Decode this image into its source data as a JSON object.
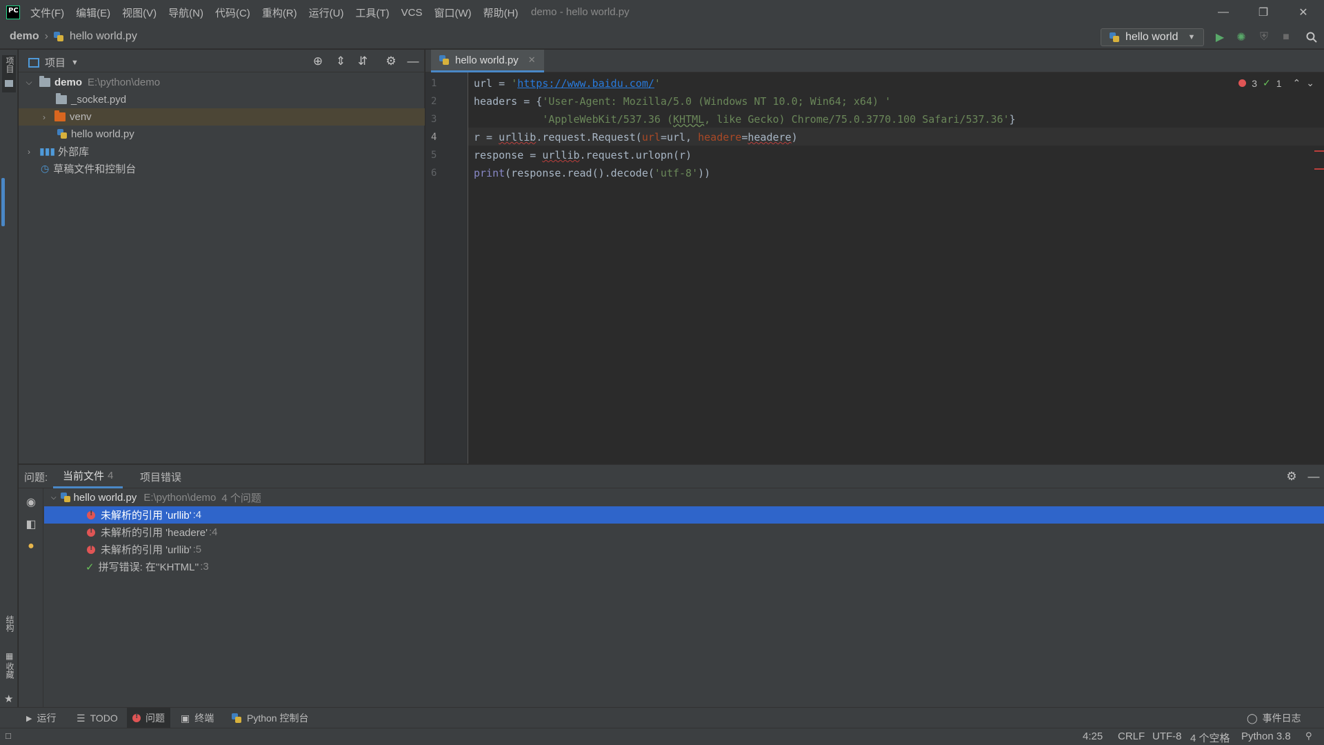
{
  "window": {
    "title": "demo - hello world.py",
    "menu": [
      "文件(F)",
      "编辑(E)",
      "视图(V)",
      "导航(N)",
      "代码(C)",
      "重构(R)",
      "运行(U)",
      "工具(T)",
      "VCS",
      "窗口(W)",
      "帮助(H)"
    ]
  },
  "breadcrumb": {
    "project": "demo",
    "file": "hello world.py"
  },
  "run_config": {
    "label": "hello world"
  },
  "left_strip": {
    "project_label": "项目",
    "structure_label": "结构",
    "favorites_label": "收藏"
  },
  "project_panel": {
    "title": "项目",
    "tree": [
      {
        "name": "demo",
        "path": "E:\\python\\demo"
      },
      {
        "name": "_socket.pyd"
      },
      {
        "name": "venv"
      },
      {
        "name": "hello world.py"
      },
      {
        "name": "外部库"
      },
      {
        "name": "草稿文件和控制台"
      }
    ]
  },
  "editor": {
    "tab": "hello world.py",
    "line_numbers": [
      "1",
      "2",
      "3",
      "4",
      "5",
      "6"
    ],
    "inspection": {
      "errors": "3",
      "warnings": "1"
    }
  },
  "problems": {
    "label": "问题:",
    "tabs": [
      {
        "label": "当前文件",
        "count": "4"
      },
      {
        "label": "项目错误"
      }
    ],
    "file": {
      "name": "hello world.py",
      "path": "E:\\python\\demo",
      "summary": "4 个问题"
    },
    "items": [
      {
        "text": "未解析的引用 'urllib'",
        "line": ":4"
      },
      {
        "text": "未解析的引用 'headere'",
        "line": ":4"
      },
      {
        "text": "未解析的引用 'urllib'",
        "line": ":5"
      },
      {
        "text": "拼写错误: 在''KHTML''",
        "line": ":3"
      }
    ]
  },
  "bottom_tools": {
    "run": "运行",
    "todo": "TODO",
    "problems": "问题",
    "terminal": "终端",
    "python_console": "Python 控制台",
    "event_log": "事件日志"
  },
  "status": {
    "position": "4:25",
    "line_sep": "CRLF",
    "encoding": "UTF-8",
    "indent": "4 个空格",
    "interpreter": "Python 3.8"
  },
  "colors": {
    "accent": "#4a88c7",
    "selection": "#2f65ca",
    "error": "#e05555",
    "ok": "#6ac35a"
  }
}
